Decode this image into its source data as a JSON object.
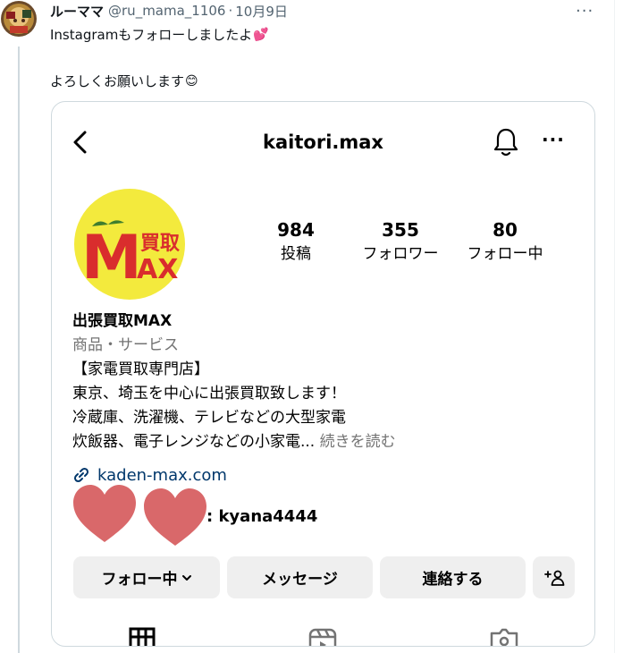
{
  "tweet": {
    "display_name": "ルーママ",
    "handle": "@ru_mama_1106",
    "separator": "·",
    "date": "10月9日",
    "more_label": "···",
    "line1": "Instagramもフォローしましたよ",
    "line1_emoji": "💕",
    "line2": "よろしくお願いします",
    "line2_emoji": "😊"
  },
  "instagram": {
    "username": "kaitori.max",
    "more_label": "···",
    "stats": [
      {
        "value": "984",
        "label": "投稿"
      },
      {
        "value": "355",
        "label": "フォロワー"
      },
      {
        "value": "80",
        "label": "フォロー中"
      }
    ],
    "logo": {
      "letter_m": "M",
      "kanji_1": "買",
      "kanji_2": "取",
      "letters_ax": "AX"
    },
    "bio": {
      "name": "出張買取MAX",
      "category": "商品・サービス",
      "line1": "【家電買取専門店】",
      "line2": "東京、埼玉を中心に出張買取致します！",
      "line3": "冷蔵庫、洗濯機、テレビなどの大型家電",
      "line4": "炊飯器、電子レンジなどの小家電...",
      "more": "続きを読む"
    },
    "link": "kaden-max.com",
    "threads_text": ": kyana4444",
    "buttons": {
      "following": "フォロー中",
      "message": "メッセージ",
      "contact": "連絡する"
    }
  },
  "colors": {
    "text": "#0f1419",
    "secondary": "#536471",
    "link": "#00376b",
    "button_bg": "#efefef",
    "logo_bg": "#f3ea3d",
    "logo_red": "#d92d2d",
    "heart": "#d9686a"
  }
}
